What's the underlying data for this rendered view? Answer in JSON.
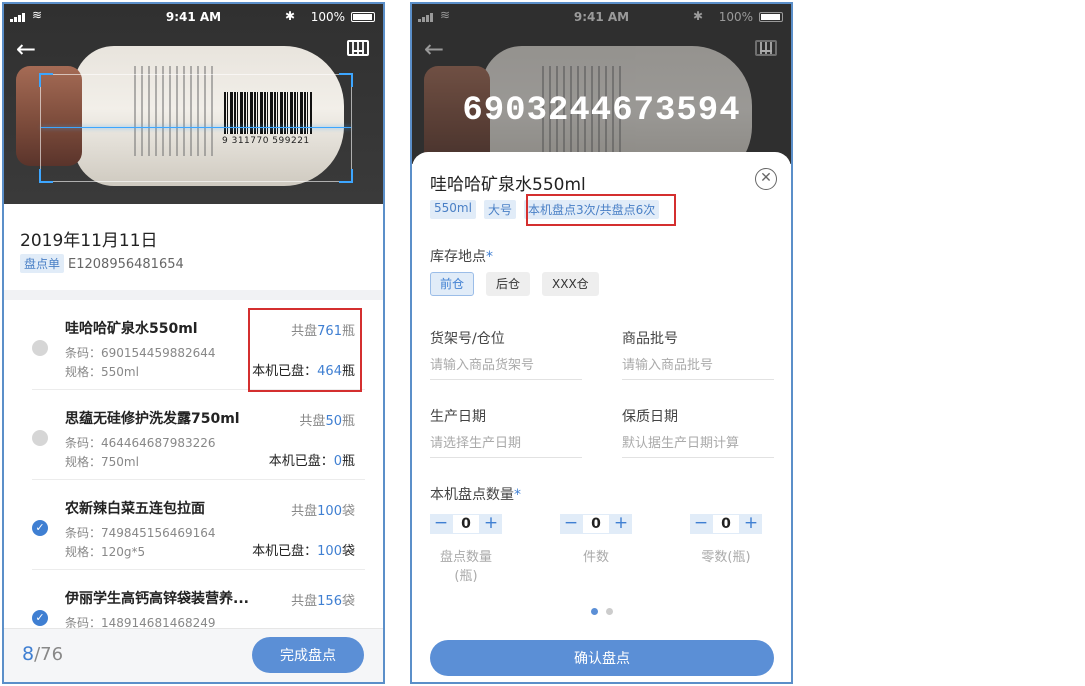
{
  "status": {
    "time": "9:41 AM",
    "battery": "100%"
  },
  "scan_list": {
    "date": "2019年11月11日",
    "doc_tag": "盘点单",
    "doc_no": "E1208956481654",
    "barcode_digits": "9 311770 599221",
    "items": [
      {
        "name": "哇哈哈矿泉水550ml",
        "barcode": "条码：690154459882644",
        "spec": "规格：550ml",
        "total_prefix": "共盘",
        "total_num": "761",
        "unit": "瓶",
        "here_prefix": "本机已盘：",
        "here_num": "464",
        "checked": false
      },
      {
        "name": "思蕴无硅修护洗发露750ml",
        "barcode": "条码：464464687983226",
        "spec": "规格：750ml",
        "total_prefix": "共盘",
        "total_num": "50",
        "unit": "瓶",
        "here_prefix": "本机已盘：",
        "here_num": "0",
        "checked": false
      },
      {
        "name": "农新辣白菜五连包拉面",
        "barcode": "条码：749845156469164",
        "spec": "规格：120g*5",
        "total_prefix": "共盘",
        "total_num": "100",
        "unit": "袋",
        "here_prefix": "本机已盘：",
        "here_num": "100",
        "checked": true
      },
      {
        "name": "伊丽学生高钙高锌袋装营养...",
        "barcode": "条码：148914681468249",
        "spec": "",
        "total_prefix": "共盘",
        "total_num": "156",
        "unit": "袋",
        "here_prefix": "",
        "here_num": "",
        "checked": true
      }
    ],
    "progress_done": "8",
    "progress_total": "/76",
    "finish_label": "完成盘点"
  },
  "detail": {
    "scanned_code": "6903244673594",
    "title": "哇哈哈矿泉水550ml",
    "tags": [
      "550ml",
      "大号",
      "本机盘点3次/共盘点6次"
    ],
    "location_label": "库存地点",
    "required_mark": "*",
    "locations": [
      "前仓",
      "后仓",
      "XXX仓"
    ],
    "selected_location": 0,
    "shelf_label": "货架号/仓位",
    "shelf_placeholder": "请输入商品货架号",
    "batch_label": "商品批号",
    "batch_placeholder": "请输入商品批号",
    "prod_date_label": "生产日期",
    "prod_date_placeholder": "请选择生产日期",
    "expiry_label": "保质日期",
    "expiry_placeholder": "默认据生产日期计算",
    "qty_label": "本机盘点数量",
    "steppers": [
      {
        "value": "0",
        "label": "盘点数量(瓶)"
      },
      {
        "value": "0",
        "label": "件数"
      },
      {
        "value": "0",
        "label": "零数(瓶)"
      }
    ],
    "page_count": 2,
    "confirm_label": "确认盘点"
  },
  "colors": {
    "accent": "#3f7fd2",
    "button": "#5b8fd6",
    "highlight": "#d42f2f",
    "scan_line": "#3da6ff"
  }
}
